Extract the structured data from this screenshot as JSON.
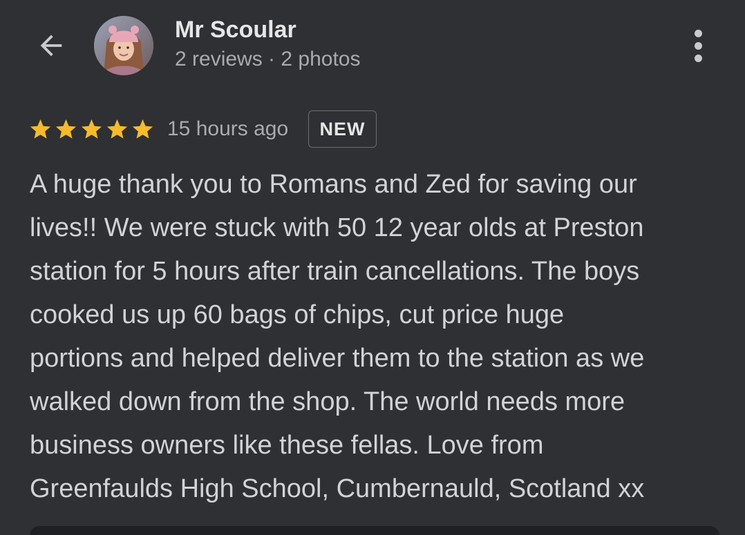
{
  "header": {
    "author_name": "Mr Scoular",
    "author_meta": "2 reviews · 2 photos",
    "back_icon": "arrow-left-icon",
    "more_icon": "more-vert-icon"
  },
  "review": {
    "rating": 5,
    "rating_max": 5,
    "star_color": "#f6bb2b",
    "time_ago": "15 hours ago",
    "badge": "NEW",
    "text_lines": [
      "A huge thank you to Romans and Zed for saving our",
      "lives!! We were stuck with 50 12 year olds at Preston",
      "station for 5 hours after train cancellations. The boys",
      "cooked us up 60 bags of chips, cut price huge",
      "portions and helped deliver them to the station as we",
      "walked down from the shop. The world needs more",
      "business owners like these fellas. Love from",
      "Greenfaulds High School, Cumbernauld, Scotland xx"
    ]
  },
  "colors": {
    "background": "#2f3033",
    "primary_text": "#e6e6e8",
    "secondary_text": "#a9abaf",
    "body_text": "#d2d3d6"
  }
}
